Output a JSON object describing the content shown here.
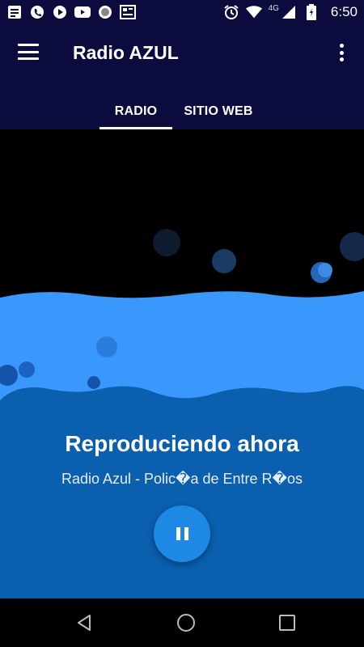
{
  "status_bar": {
    "time": "6:50",
    "network": "4G",
    "icons_left": [
      "notes-icon",
      "phone-icon",
      "play-store-icon",
      "youtube-icon",
      "circle-app-icon",
      "news-icon"
    ],
    "icons_right": [
      "alarm-icon",
      "wifi-icon",
      "signal-icon",
      "battery-icon"
    ]
  },
  "app_bar": {
    "title": "Radio AZUL",
    "menu_icon": "hamburger-menu-icon",
    "overflow_icon": "overflow-menu-icon"
  },
  "tabs": [
    {
      "label": "RADIO",
      "selected": true
    },
    {
      "label": "SITIO WEB",
      "selected": false
    }
  ],
  "player": {
    "heading": "Reproduciendo ahora",
    "station": "Radio Azul - Polic�a de Entre R�os",
    "state": "playing",
    "button_icon": "pause-icon"
  },
  "nav_bar": {
    "back": "back-icon",
    "home": "home-icon",
    "recents": "recents-icon"
  },
  "colors": {
    "app_bar": "#0b0b3e",
    "wave_light": "#3a97fb",
    "wave_dark": "#0a5fae",
    "button": "#1e88e5",
    "bubble_dark": "#1b2a46"
  }
}
